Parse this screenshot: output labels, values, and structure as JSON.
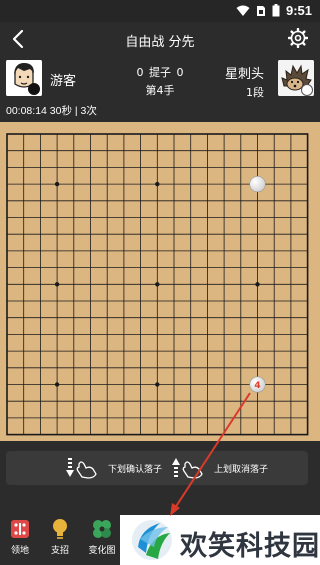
{
  "status_bar": {
    "time": "9:51",
    "icons": [
      "wifi-icon",
      "sim-icon",
      "battery-icon"
    ]
  },
  "header": {
    "title": "自由战 分先",
    "back_icon": "chevron-left-icon",
    "settings_icon": "gear-icon"
  },
  "players": {
    "left": {
      "name": "游客",
      "stone": "black"
    },
    "right": {
      "name": "星刺头",
      "rank": "1段",
      "stone": "white"
    }
  },
  "game": {
    "captures_left": "0",
    "captures_label": "提子",
    "captures_right": "0",
    "move_text": "第4手",
    "time_text": "00:08:14  30秒 | 3次"
  },
  "board": {
    "size": 19,
    "colors": {
      "wood": "#dcb681",
      "line": "#1a1a1a",
      "last_move_marker": "#e03a2a"
    },
    "star_points": [
      [
        3,
        3
      ],
      [
        3,
        9
      ],
      [
        3,
        15
      ],
      [
        9,
        3
      ],
      [
        9,
        9
      ],
      [
        9,
        15
      ],
      [
        15,
        3
      ],
      [
        15,
        9
      ],
      [
        15,
        15
      ]
    ],
    "stones": [
      {
        "col": 15,
        "row": 3,
        "color": "white"
      },
      {
        "col": 15,
        "row": 15,
        "color": "white",
        "label": "4"
      }
    ]
  },
  "hint": {
    "down_text": "下划确认落子",
    "up_text": "上划取消落子"
  },
  "toolbar": {
    "items": [
      {
        "label": "领地",
        "icon": "territory-icon",
        "color": "#e04848"
      },
      {
        "label": "支招",
        "icon": "lightbulb-icon",
        "color": "#e8b33a"
      },
      {
        "label": "变化图",
        "icon": "variation-icon",
        "color": "#3aa65a"
      }
    ]
  },
  "watermark": {
    "text": "欢笑科技园"
  }
}
